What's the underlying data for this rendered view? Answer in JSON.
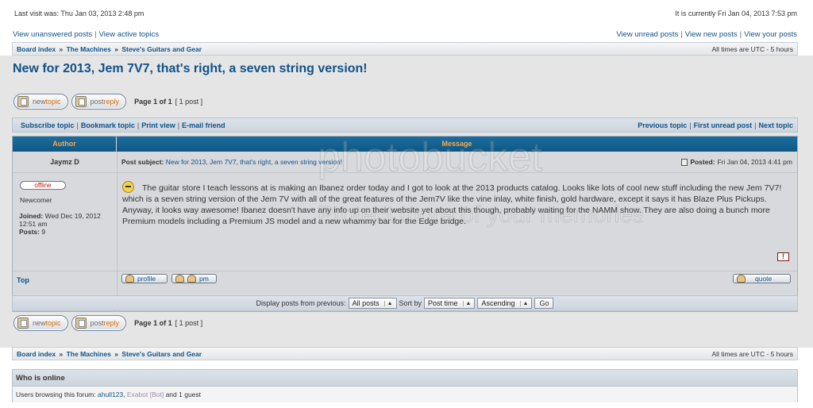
{
  "header": {
    "last_visit": "Last visit was: Thu Jan 03, 2013 2:48 pm",
    "current_time": "It is currently Fri Jan 04, 2013 7:53 pm"
  },
  "nav": {
    "left": [
      "View unanswered posts",
      "View active topics"
    ],
    "right": [
      "View unread posts",
      "View new posts",
      "View your posts"
    ]
  },
  "breadcrumb": {
    "items": [
      "Board index",
      "The Machines",
      "Steve's Guitars and Gear"
    ],
    "separator": "»",
    "timezone": "All times are UTC - 5 hours"
  },
  "topic": {
    "title": "New for 2013, Jem 7V7, that's right, a seven string version!"
  },
  "buttons": {
    "new_topic_a": "new",
    "new_topic_b": "topic",
    "post_reply_a": "post",
    "post_reply_b": "reply"
  },
  "pagination": {
    "page": "Page 1 of 1",
    "posts": "[ 1 post ]"
  },
  "topic_tools": {
    "left": [
      "Subscribe topic",
      "Bookmark topic",
      "Print view",
      "E-mail friend"
    ],
    "right": [
      "Previous topic",
      "First unread post",
      "Next topic"
    ]
  },
  "table": {
    "col_author": "Author",
    "col_message": "Message"
  },
  "post": {
    "author": "Jaymz D",
    "status": "offline",
    "rank": "Newcomer",
    "joined_label": "Joined:",
    "joined_value": "Wed Dec 19, 2012 12:51 am",
    "posts_label": "Posts:",
    "posts_value": "9",
    "subject_label": "Post subject:",
    "subject": "New for 2013, Jem 7V7, that's right, a seven string version!",
    "posted_label": "Posted:",
    "posted_value": "Fri Jan 04, 2013 4:41 pm",
    "body": "The guitar store I teach lessons at is making an Ibanez order today and I got to look at the 2013 products catalog. Looks like lots of cool new stuff including the new Jem 7V7! which is a seven string version of the Jem 7V with all of the great features of the Jem7V like the vine inlay, white finish, gold hardware, except it says it has Blaze Plus Pickups. Anyway, it looks way awesome! Ibanez doesn't have any info up on their website yet about this though, probably waiting for the NAMM show. They are also doing a bunch more Premium models including a Premium JS model and a new whammy bar for the Edge bridge.",
    "report_icon": "!",
    "top_link": "Top",
    "profile_btn": "profile",
    "pm_btn": "pm",
    "quote_btn": "quote"
  },
  "sort": {
    "label": "Display posts from previous:",
    "from_value": "All posts",
    "sort_label": "Sort by",
    "sort_value": "Post time",
    "order_value": "Ascending",
    "go": "Go"
  },
  "online": {
    "title": "Who is online",
    "prefix": "Users browsing this forum:",
    "user": "ahull123",
    "comma": ",",
    "bot": "Exabot [Bot]",
    "suffix": "and 1 guest"
  },
  "watermark": {
    "text1": "photobucket",
    "text2": "Protect more of your memories for less!"
  },
  "colors": {
    "link": "#105289",
    "header_blue": "#1c6e9f",
    "header_text": "#fba74a",
    "offline_red": "#c2160e"
  }
}
